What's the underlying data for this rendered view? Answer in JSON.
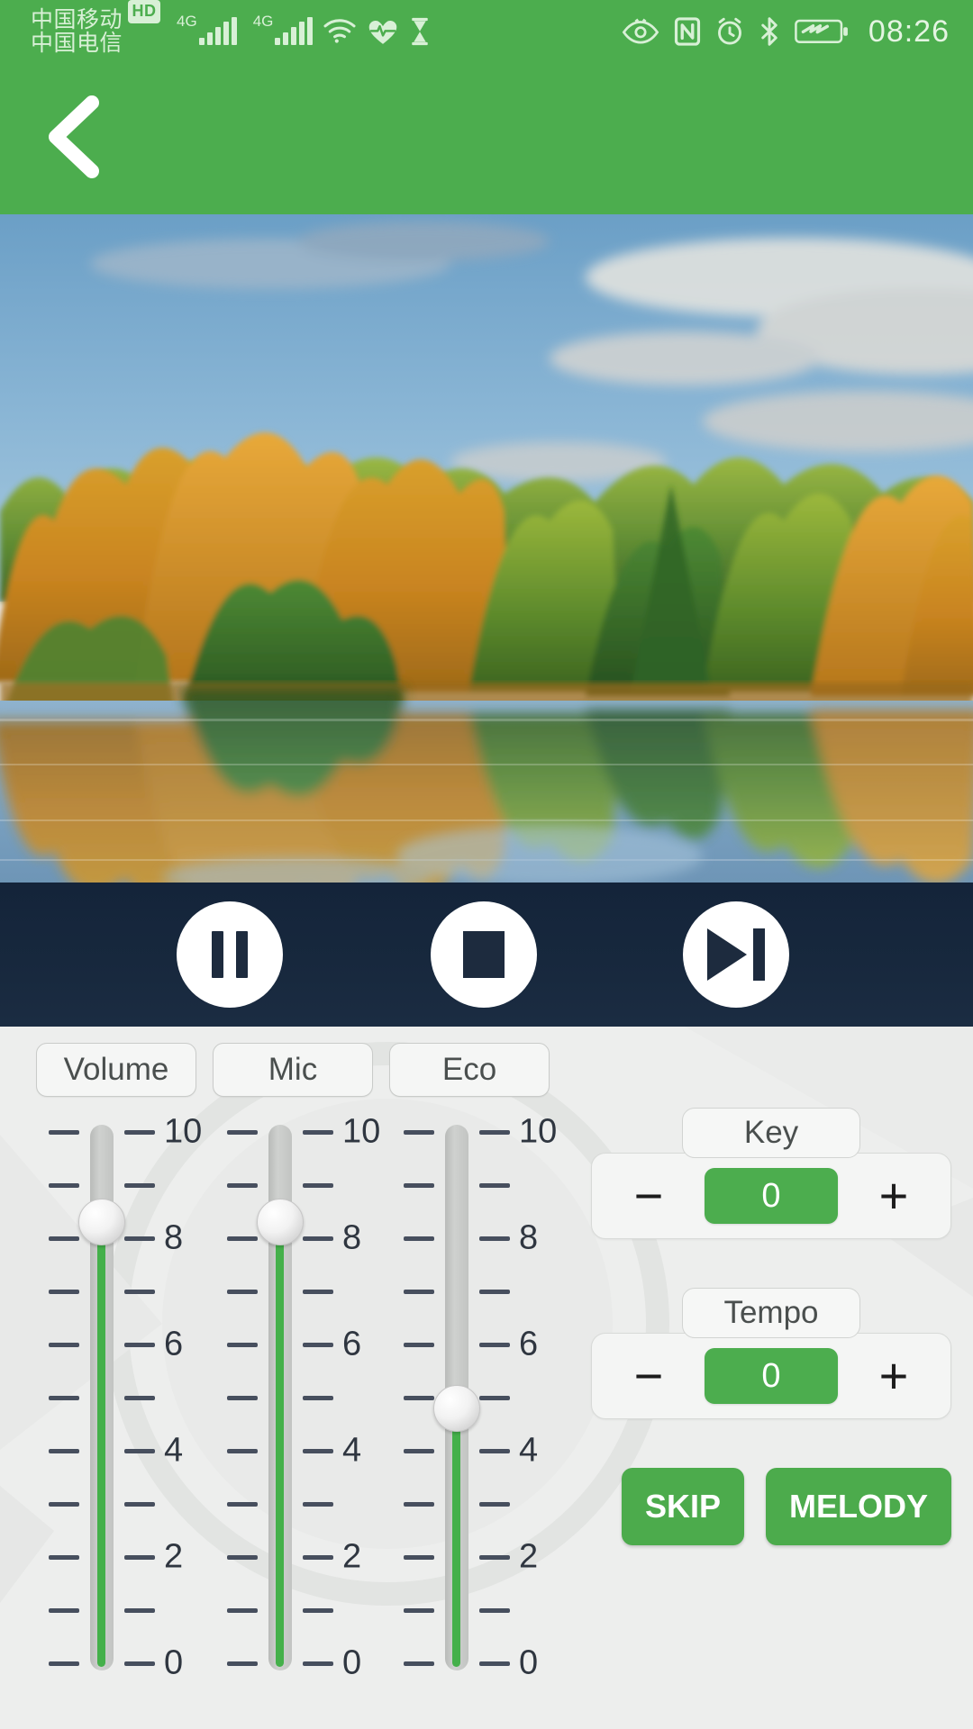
{
  "status_bar": {
    "carrier_primary": "中国移动",
    "carrier_secondary": "中国电信",
    "hd_badge": "HD",
    "network_1": "4G",
    "network_2": "4G",
    "time": "08:26",
    "icons": [
      "wifi-icon",
      "heart-rate-icon",
      "hourglass-icon",
      "eye-comfort-icon",
      "nfc-icon",
      "alarm-icon",
      "bluetooth-icon",
      "battery-icon"
    ]
  },
  "appbar": {
    "back_icon": "chevron-left-icon"
  },
  "media": {
    "image_alt": "autumn-lake-reflection-photo",
    "controls": [
      {
        "name": "pause-button",
        "icon": "pause-icon"
      },
      {
        "name": "stop-button",
        "icon": "stop-icon"
      },
      {
        "name": "next-button",
        "icon": "skip-next-icon"
      }
    ]
  },
  "panel": {
    "tabs": [
      {
        "label": "Volume"
      },
      {
        "label": "Mic"
      },
      {
        "label": "Eco"
      }
    ],
    "sliders": [
      {
        "name": "volume",
        "value": 8.3,
        "min": 0,
        "max": 10
      },
      {
        "name": "mic",
        "value": 8.3,
        "min": 0,
        "max": 10
      },
      {
        "name": "eco",
        "value": 4.8,
        "min": 0,
        "max": 10
      }
    ],
    "scale_labels": [
      "10",
      "8",
      "6",
      "4",
      "2",
      "0"
    ],
    "steppers": [
      {
        "label": "Key",
        "value": "0",
        "minus": "−",
        "plus": "+"
      },
      {
        "label": "Tempo",
        "value": "0",
        "minus": "−",
        "plus": "+"
      }
    ],
    "actions": [
      {
        "label": "SKIP"
      },
      {
        "label": "MELODY"
      }
    ]
  },
  "colors": {
    "brand_green": "#4cad4e",
    "accent_green": "#44b04a",
    "panel_bg": "#edeeed",
    "transport_bg": "#17283d",
    "tick": "#474f5e"
  }
}
